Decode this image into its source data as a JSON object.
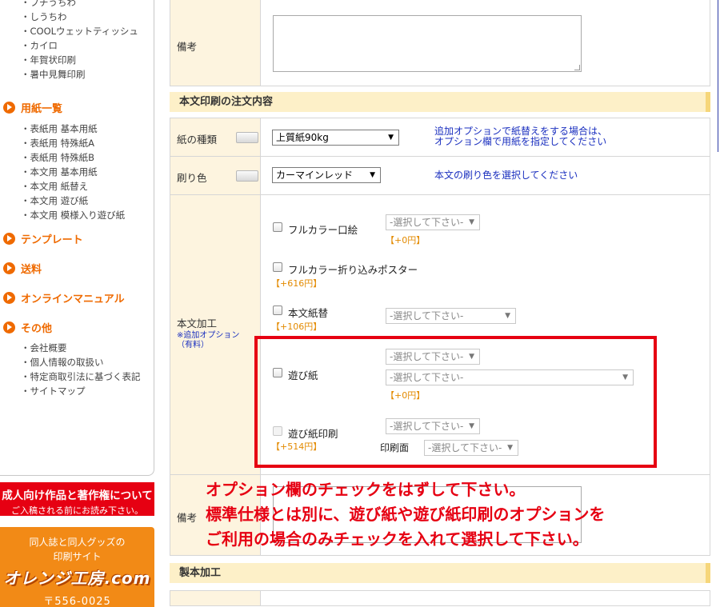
{
  "sidebar": {
    "top_items": [
      "・プチうちわ",
      "・しうちわ",
      "・COOLウェットティッシュ",
      "・カイロ",
      "・年賀状印刷",
      "・暑中見舞印刷"
    ],
    "paper_title": "用紙一覧",
    "paper_items": [
      "・表紙用 基本用紙",
      "・表紙用 特殊紙A",
      "・表紙用 特殊紙B",
      "・本文用 基本用紙",
      "・本文用 紙替え",
      "・本文用 遊び紙",
      "・本文用 模様入り遊び紙"
    ],
    "template_title": "テンプレート",
    "shipping_title": "送料",
    "manual_title": "オンラインマニュアル",
    "other_title": "その他",
    "other_items": [
      "・会社概要",
      "・個人情報の取扱い",
      "・特定商取引法に基づく表記",
      "・サイトマップ"
    ],
    "copyright_banner": {
      "line1": "成人向け作品と著作権について",
      "line2": "ご入稿される前にお読み下さい。"
    },
    "orange_banner": {
      "line1": "同人誌と同人グッズの",
      "line2": "印刷サイト",
      "logo": "オレンジ工房.com",
      "postal": "〒556-0025"
    }
  },
  "remarks_top": {
    "label": "備考"
  },
  "body_section": {
    "title": "本文印刷の注文内容",
    "paper_type": {
      "label": "紙の種類",
      "value": "上質紙90kg",
      "note_line1": "追加オプションで紙替えをする場合は、",
      "note_line2": "オプション欄で用紙を指定してください"
    },
    "print_color": {
      "label": "刷り色",
      "value": "カーマインレッド",
      "note": "本文の刷り色を選択してください"
    },
    "processing": {
      "label": "本文加工",
      "note_line1": "※追加オプション",
      "note_line2": "（有料）",
      "options": {
        "full_color_frontispiece": {
          "label": "フルカラー口絵",
          "price": "【+0円】",
          "select": "-選択して下さい-"
        },
        "full_color_poster": {
          "label": "フルカラー折り込みポスター",
          "price": "【+616円】"
        },
        "paper_change": {
          "label": "本文紙替",
          "price": "【+106円】",
          "select": "-選択して下さい-"
        },
        "flyleaf": {
          "label": "遊び紙",
          "price": "【+0円】",
          "select1": "-選択して下さい-",
          "select2": "-選択して下さい-"
        },
        "flyleaf_print": {
          "label": "遊び紙印刷",
          "price": "【+514円】",
          "select": "-選択して下さい-",
          "side_label": "印刷面",
          "side_select": "-選択して下さい-"
        }
      }
    },
    "remarks": {
      "label": "備考"
    }
  },
  "binding_section": {
    "title": "製本加工"
  },
  "annotation": {
    "line1": "オプション欄のチェックをはずして下さい。",
    "line2": "標準仕様とは別に、遊び紙や遊び紙印刷のオプションを",
    "line3": "ご利用の場合のみチェックを入れて選択して下さい。"
  },
  "colors": {
    "accent_orange": "#ef6a00",
    "label_bg": "#fdf4df",
    "section_bg": "#fdf0c8",
    "note_blue": "#1a2fbf",
    "price_orange": "#e38a00",
    "highlight_red": "#e60012"
  }
}
